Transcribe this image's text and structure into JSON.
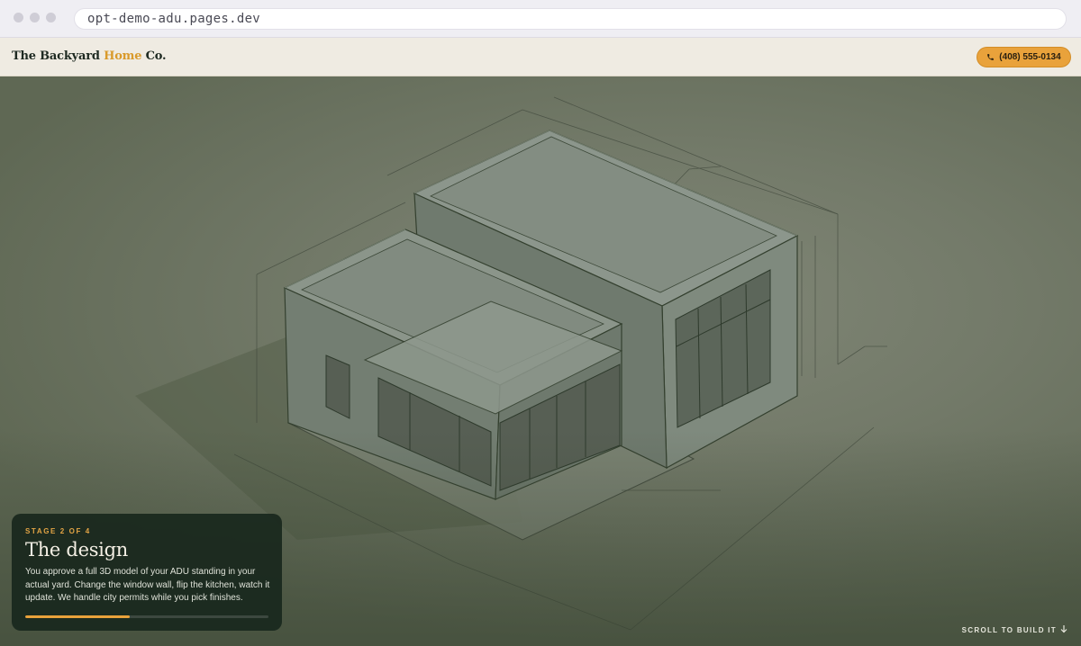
{
  "browser": {
    "url": "opt-demo-adu.pages.dev"
  },
  "header": {
    "brand_prefix": "The Backyard ",
    "brand_accent": "Home",
    "brand_suffix": " Co.",
    "phone_label": "(408) 555-0134",
    "phone_icon": "phone-icon"
  },
  "hero": {
    "illustration": "isometric ADU blueprint model"
  },
  "stage": {
    "eyebrow": "STAGE 2 OF 4",
    "title": "The design",
    "description": "You approve a full 3D model of your ADU standing in your actual yard. Change the window wall, flip the kitchen, watch it update. We handle city permits while you pick finishes.",
    "progress": 0.43
  },
  "scroll_hint": {
    "label": "SCROLL TO BUILD IT",
    "icon": "arrow-down-icon"
  },
  "colors": {
    "accent": "#e9a23b",
    "card_background": "#1a281e",
    "hero_background": "#737a69",
    "header_background": "#efebe2"
  }
}
